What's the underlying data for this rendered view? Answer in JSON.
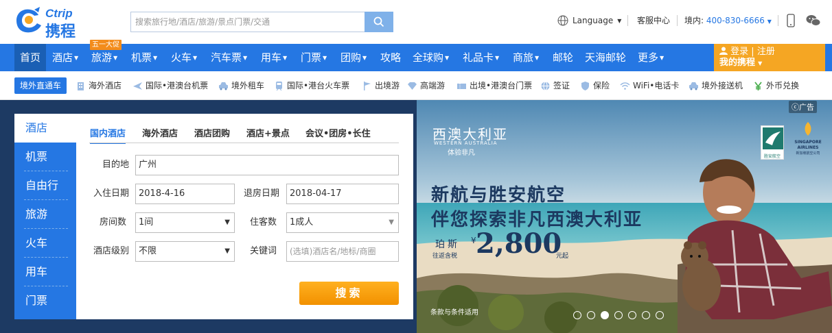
{
  "header": {
    "logo_en": "Ctrip",
    "logo_cn": "携程",
    "search_placeholder": "搜索旅行地/酒店/旅游/景点门票/交通",
    "language": "Language",
    "customer_service": "客服中心",
    "phone_label": "境内:",
    "phone_number": "400-830-6666"
  },
  "nav": {
    "promo_badge": "五一大促",
    "items": [
      "首页",
      "酒店",
      "旅游",
      "机票",
      "火车",
      "汽车票",
      "用车",
      "门票",
      "团购",
      "攻略",
      "全球购",
      "礼品卡",
      "商旅",
      "邮轮",
      "天海邮轮",
      "更多"
    ],
    "login": "登录",
    "register": "注册",
    "my_ctrip": "我的携程"
  },
  "subnav": {
    "badge": "境外直通车",
    "items": [
      "海外酒店",
      "国际•港澳台机票",
      "境外租车",
      "国际•港台火车票",
      "出境游",
      "高端游",
      "出境•港澳台门票",
      "签证",
      "保险",
      "WiFi•电话卡",
      "境外接送机",
      "外币兑换"
    ]
  },
  "sidetabs": [
    "酒店",
    "机票",
    "自由行",
    "旅游",
    "火车",
    "用车",
    "门票"
  ],
  "hotel_panel": {
    "tabs": [
      "国内酒店",
      "海外酒店",
      "酒店团购",
      "酒店+景点",
      "会议•团房•长住"
    ],
    "destination_label": "目的地",
    "destination_value": "广州",
    "checkin_label": "入住日期",
    "checkin_value": "2018-4-16",
    "checkout_label": "退房日期",
    "checkout_value": "2018-04-17",
    "rooms_label": "房间数",
    "rooms_value": "1间",
    "guests_label": "住客数",
    "guests_value": "1成人",
    "level_label": "酒店级别",
    "level_value": "不限",
    "keyword_label": "关键词",
    "keyword_placeholder": "(选填)酒店名/地标/商圈",
    "search_button": "搜索"
  },
  "ad": {
    "tag": "广告",
    "title_cn": "西澳大利亚",
    "title_en": "WESTERN AUSTRALIA",
    "tagline": "体验非凡",
    "headline1": "新航与胜安航空",
    "headline2": "伴您探索非凡西澳大利亚",
    "city": "珀斯",
    "round_trip": "往返含税",
    "currency": "¥",
    "price": "2,800",
    "price_suffix": "元起",
    "terms": "条款与条件适用",
    "airline1": "胜安航空",
    "airline2": "SINGAPORE AIRLINES",
    "airline2_cn": "新加坡航空公司",
    "carousel_count": 7,
    "carousel_active": 3
  },
  "colors": {
    "brand_blue": "#2577e3",
    "promo_orange": "#f38c1b",
    "search_orange": "#f5a623",
    "dark_blue": "#1c3960"
  }
}
